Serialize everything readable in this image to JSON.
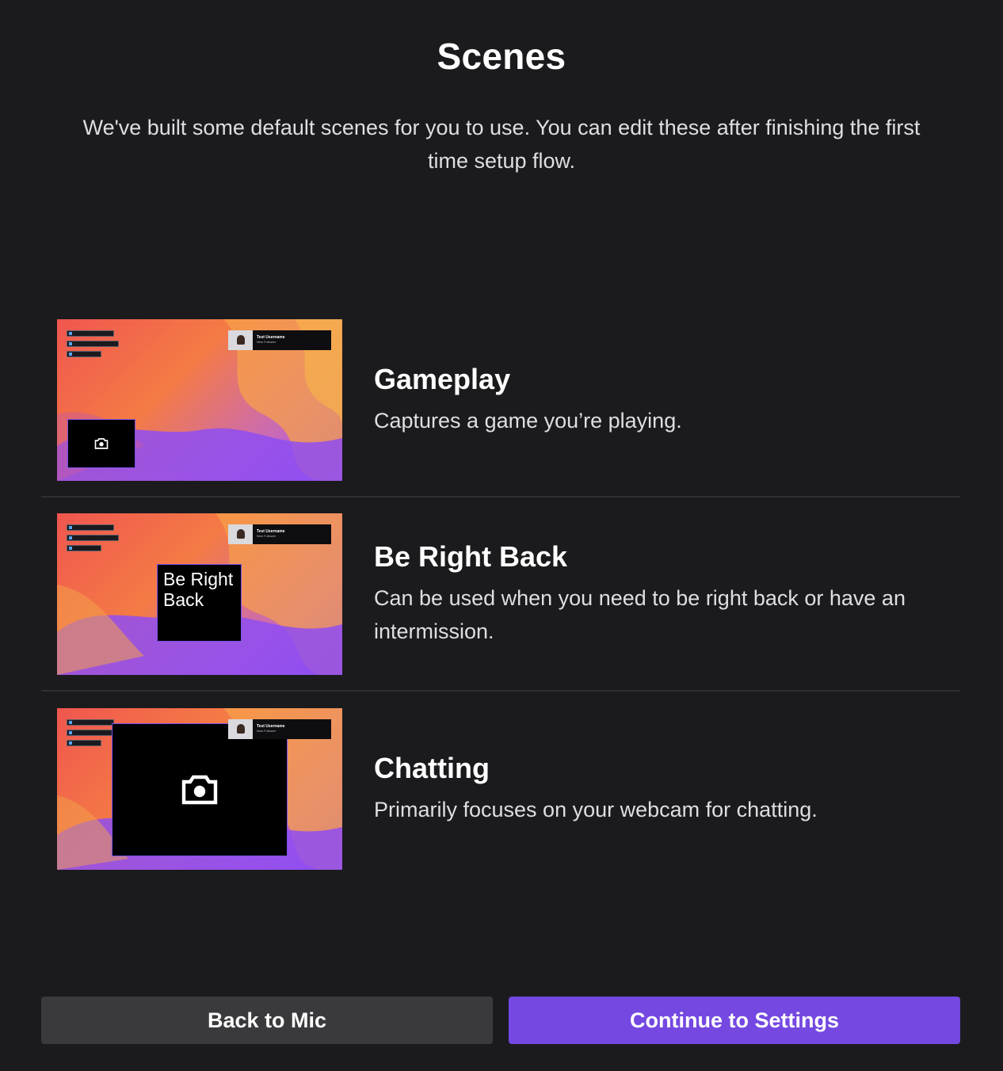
{
  "header": {
    "title": "Scenes",
    "subtitle": "We've built some default scenes for you to use. You can edit these after finishing the first time setup flow."
  },
  "preview_overlay": {
    "follower_name": "Test Username",
    "follower_event": "New Follower",
    "avatar_icon": "avatar-image",
    "camera_icon": "camera-icon"
  },
  "scenes": [
    {
      "name": "Gameplay",
      "description": "Captures a game you’re playing.",
      "preview_type": "small-webcam"
    },
    {
      "name": "Be Right Back",
      "description": "Can be used when you need to be right back or have an intermission.",
      "preview_type": "brb-text",
      "preview_text": "Be Right Back"
    },
    {
      "name": "Chatting",
      "description": "Primarily focuses on your webcam for chatting.",
      "preview_type": "large-webcam"
    }
  ],
  "footer": {
    "back_label": "Back to Mic",
    "continue_label": "Continue to Settings"
  },
  "colors": {
    "background": "#1b1b1e",
    "accent": "#7448e1",
    "secondary_button": "#3a3a3d"
  }
}
